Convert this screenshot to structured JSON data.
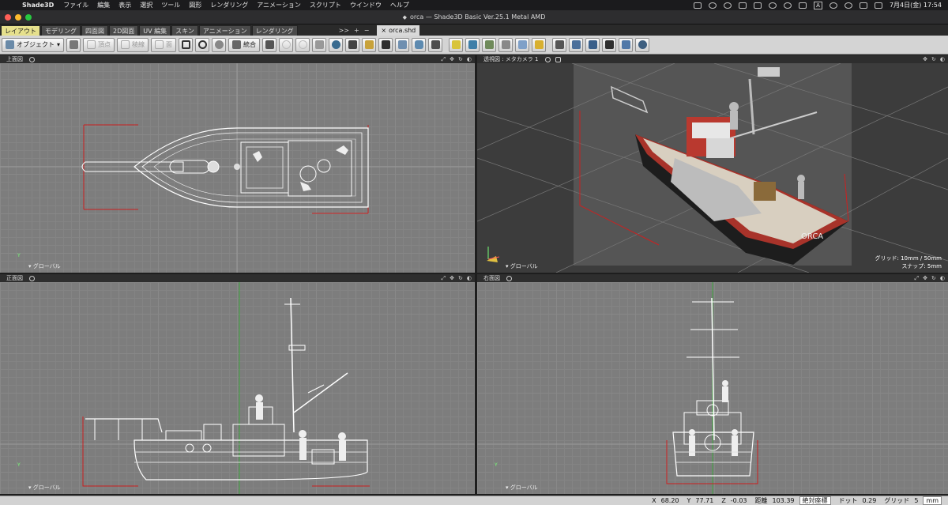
{
  "menubar": {
    "app_name": "Shade3D",
    "menus": [
      "ファイル",
      "編集",
      "表示",
      "選択",
      "ツール",
      "図形",
      "レンダリング",
      "アニメーション",
      "スクリプト",
      "ウインドウ",
      "ヘルプ"
    ],
    "input_mode": "A",
    "clock": "7月4日(金)  17:54"
  },
  "window": {
    "title": "orca — Shade3D Basic Ver.25.1 Metal AMD"
  },
  "tabs": {
    "items": [
      "レイアウト",
      "モデリング",
      "四面図",
      "2D図面",
      "UV 編集",
      "スキン",
      "アニメーション",
      "レンダリング"
    ],
    "more": ">>",
    "add": "+",
    "remove": "−",
    "document_tab": "orca.shd"
  },
  "toolbar": {
    "object_label": "オブジェクト",
    "vertex_label": "頂点",
    "edge_label": "稜線",
    "face_label": "面",
    "merge_label": "統合"
  },
  "viewports": {
    "top": {
      "title": "上面図",
      "footer": "▾ グローバル"
    },
    "perspective": {
      "title": "透視図 : メタカメラ 1",
      "footer": "▾ グローバル",
      "grid_info": "グリッド: 10mm / 50mm",
      "snap_info": "スナップ: 5mm"
    },
    "front": {
      "title": "正面図",
      "footer": "▾ グローバル"
    },
    "side": {
      "title": "右面図",
      "footer": "▾ グローバル"
    },
    "axis_y": "Y",
    "axis_x": "X"
  },
  "status": {
    "x_label": "X",
    "x_value": "68.20",
    "y_label": "Y",
    "y_value": "77.71",
    "z_label": "Z",
    "z_value": "-0.03",
    "distance_label": "距離",
    "distance_value": "103.39",
    "coord_mode": "絶対座標",
    "dot_label": "ドット",
    "dot_value": "0.29",
    "grid_label": "グリッド",
    "grid_value": "5",
    "unit": "mm"
  },
  "colors": {
    "tab_active": "#e6e08c",
    "boat_hull": "#b2342a",
    "wire": "#ffffff",
    "guide_red": "#cc2020"
  }
}
